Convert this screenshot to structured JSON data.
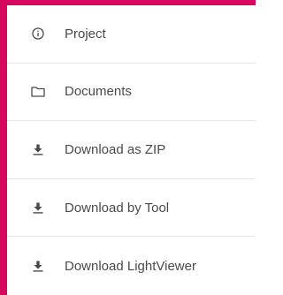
{
  "menu": {
    "items": [
      {
        "label": "Project",
        "icon": "info-icon"
      },
      {
        "label": "Documents",
        "icon": "folder-icon"
      },
      {
        "label": "Download as ZIP",
        "icon": "download-icon"
      },
      {
        "label": "Download by Tool",
        "icon": "download-icon"
      },
      {
        "label": "Download LightViewer",
        "icon": "download-icon"
      }
    ]
  },
  "colors": {
    "accent": "#d6075e",
    "text": "#4a4a4a",
    "divider": "#e6e6e6"
  }
}
